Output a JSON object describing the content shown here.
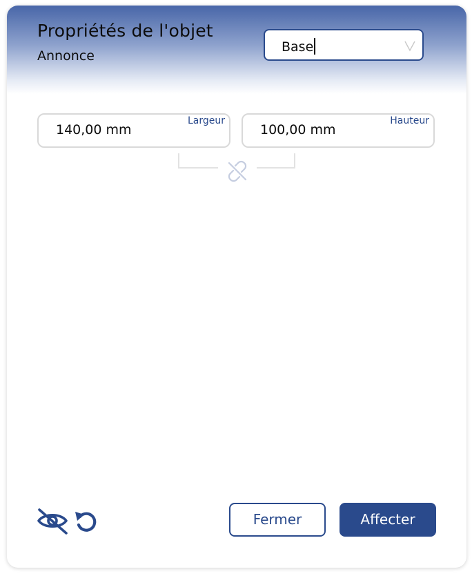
{
  "header": {
    "title": "Propriétés de l'objet",
    "subtitle": "Annonce"
  },
  "style_select": {
    "value": "Base",
    "icon": "chevron-down-icon"
  },
  "dimensions": {
    "width": {
      "label": "Largeur",
      "value": "140,00 mm"
    },
    "height": {
      "label": "Hauteur",
      "value": "100,00 mm"
    },
    "link_icon": "unlink-icon"
  },
  "footer": {
    "visibility_icon": "eye-off-icon",
    "reset_icon": "undo-icon",
    "close_label": "Fermer",
    "apply_label": "Affecter"
  },
  "colors": {
    "accent": "#2a4a8c",
    "header_top": "#4866a8",
    "border": "#d9d9d9",
    "icon_muted": "#c5cde0"
  }
}
